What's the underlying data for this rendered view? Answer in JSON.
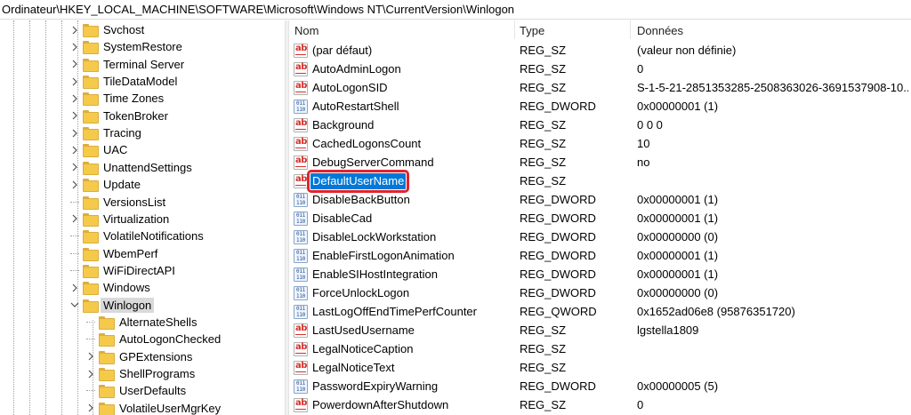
{
  "address": "Ordinateur\\HKEY_LOCAL_MACHINE\\SOFTWARE\\Microsoft\\Windows NT\\CurrentVersion\\Winlogon",
  "tree": [
    {
      "label": "Svchost",
      "expander": "collapsed"
    },
    {
      "label": "SystemRestore",
      "expander": "collapsed"
    },
    {
      "label": "Terminal Server",
      "expander": "collapsed"
    },
    {
      "label": "TileDataModel",
      "expander": "collapsed"
    },
    {
      "label": "Time Zones",
      "expander": "collapsed"
    },
    {
      "label": "TokenBroker",
      "expander": "collapsed"
    },
    {
      "label": "Tracing",
      "expander": "collapsed"
    },
    {
      "label": "UAC",
      "expander": "collapsed"
    },
    {
      "label": "UnattendSettings",
      "expander": "collapsed"
    },
    {
      "label": "Update",
      "expander": "collapsed"
    },
    {
      "label": "VersionsList",
      "expander": "none"
    },
    {
      "label": "Virtualization",
      "expander": "collapsed"
    },
    {
      "label": "VolatileNotifications",
      "expander": "none"
    },
    {
      "label": "WbemPerf",
      "expander": "none"
    },
    {
      "label": "WiFiDirectAPI",
      "expander": "none"
    },
    {
      "label": "Windows",
      "expander": "collapsed"
    },
    {
      "label": "Winlogon",
      "expander": "expanded",
      "selected": true
    },
    {
      "label": "AlternateShells",
      "expander": "none",
      "child": true
    },
    {
      "label": "AutoLogonChecked",
      "expander": "none",
      "child": true
    },
    {
      "label": "GPExtensions",
      "expander": "collapsed",
      "child": true
    },
    {
      "label": "ShellPrograms",
      "expander": "collapsed",
      "child": true
    },
    {
      "label": "UserDefaults",
      "expander": "none",
      "child": true
    },
    {
      "label": "VolatileUserMgrKey",
      "expander": "collapsed",
      "child": true
    }
  ],
  "columns": {
    "name": "Nom",
    "type": "Type",
    "data": "Données"
  },
  "values": [
    {
      "name": "(par défaut)",
      "type": "REG_SZ",
      "data": "(valeur non définie)",
      "icon": "string-value-icon"
    },
    {
      "name": "AutoAdminLogon",
      "type": "REG_SZ",
      "data": "0",
      "icon": "string-value-icon"
    },
    {
      "name": "AutoLogonSID",
      "type": "REG_SZ",
      "data": "S-1-5-21-2851353285-2508363026-3691537908-10...",
      "icon": "string-value-icon"
    },
    {
      "name": "AutoRestartShell",
      "type": "REG_DWORD",
      "data": "0x00000001 (1)",
      "icon": "binary-value-icon"
    },
    {
      "name": "Background",
      "type": "REG_SZ",
      "data": "0 0 0",
      "icon": "string-value-icon"
    },
    {
      "name": "CachedLogonsCount",
      "type": "REG_SZ",
      "data": "10",
      "icon": "string-value-icon"
    },
    {
      "name": "DebugServerCommand",
      "type": "REG_SZ",
      "data": "no",
      "icon": "string-value-icon"
    },
    {
      "name": "DefaultUserName",
      "type": "REG_SZ",
      "data": "",
      "icon": "string-value-icon",
      "highlighted": true
    },
    {
      "name": "DisableBackButton",
      "type": "REG_DWORD",
      "data": "0x00000001 (1)",
      "icon": "binary-value-icon"
    },
    {
      "name": "DisableCad",
      "type": "REG_DWORD",
      "data": "0x00000001 (1)",
      "icon": "binary-value-icon"
    },
    {
      "name": "DisableLockWorkstation",
      "type": "REG_DWORD",
      "data": "0x00000000 (0)",
      "icon": "binary-value-icon"
    },
    {
      "name": "EnableFirstLogonAnimation",
      "type": "REG_DWORD",
      "data": "0x00000001 (1)",
      "icon": "binary-value-icon"
    },
    {
      "name": "EnableSIHostIntegration",
      "type": "REG_DWORD",
      "data": "0x00000001 (1)",
      "icon": "binary-value-icon"
    },
    {
      "name": "ForceUnlockLogon",
      "type": "REG_DWORD",
      "data": "0x00000000 (0)",
      "icon": "binary-value-icon"
    },
    {
      "name": "LastLogOffEndTimePerfCounter",
      "type": "REG_QWORD",
      "data": "0x1652ad06e8 (95876351720)",
      "icon": "binary-value-icon"
    },
    {
      "name": "LastUsedUsername",
      "type": "REG_SZ",
      "data": "lgstella1809",
      "icon": "string-value-icon"
    },
    {
      "name": "LegalNoticeCaption",
      "type": "REG_SZ",
      "data": "",
      "icon": "string-value-icon"
    },
    {
      "name": "LegalNoticeText",
      "type": "REG_SZ",
      "data": "",
      "icon": "string-value-icon"
    },
    {
      "name": "PasswordExpiryWarning",
      "type": "REG_DWORD",
      "data": "0x00000005 (5)",
      "icon": "binary-value-icon"
    },
    {
      "name": "PowerdownAfterShutdown",
      "type": "REG_SZ",
      "data": "0",
      "icon": "string-value-icon"
    }
  ],
  "colors": {
    "selection": "#0078d7",
    "highlight_box": "#e0242e",
    "folder": "#f5c94a",
    "string_icon": "#d6302a",
    "binary_icon": "#1f4e9a"
  }
}
